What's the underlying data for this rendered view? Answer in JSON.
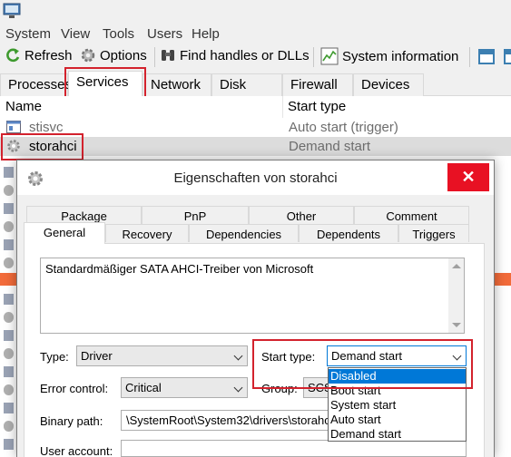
{
  "menu": [
    "System",
    "View",
    "Tools",
    "Users",
    "Help"
  ],
  "toolbar": {
    "refresh": "Refresh",
    "options": "Options",
    "find": "Find handles or DLLs",
    "sysinfo": "System information"
  },
  "tabs": [
    "Processes",
    "Services",
    "Network",
    "Disk",
    "Firewall",
    "Devices"
  ],
  "list": {
    "col_name": "Name",
    "col_type": "Start type",
    "rows": [
      {
        "name": "stisvc",
        "start": "Auto start (trigger)"
      },
      {
        "name": "storahci",
        "start": "Demand start"
      }
    ]
  },
  "dialog": {
    "title": "Eigenschaften von storahci",
    "close": "✕",
    "tabs_top": [
      "Package",
      "PnP",
      "Other",
      "Comment"
    ],
    "tabs_bottom": [
      "General",
      "Recovery",
      "Dependencies",
      "Dependents",
      "Triggers"
    ],
    "description": "Standardmäßiger SATA AHCI-Treiber von Microsoft",
    "type_label": "Type:",
    "type_value": "Driver",
    "start_label": "Start type:",
    "start_value": "Demand start",
    "error_label": "Error control:",
    "error_value": "Critical",
    "group_label": "Group:",
    "group_value": "SCS",
    "binary_label": "Binary path:",
    "binary_value": "\\SystemRoot\\System32\\drivers\\storahci.sys",
    "user_label": "User account:",
    "dropdown": [
      "Disabled",
      "Boot start",
      "System start",
      "Auto start",
      "Demand start"
    ]
  },
  "colors": {
    "highlight_outline": "#d3222d",
    "selection": "#0078d7",
    "close_button": "#e81123",
    "accent_bar": "#f26b3a"
  }
}
